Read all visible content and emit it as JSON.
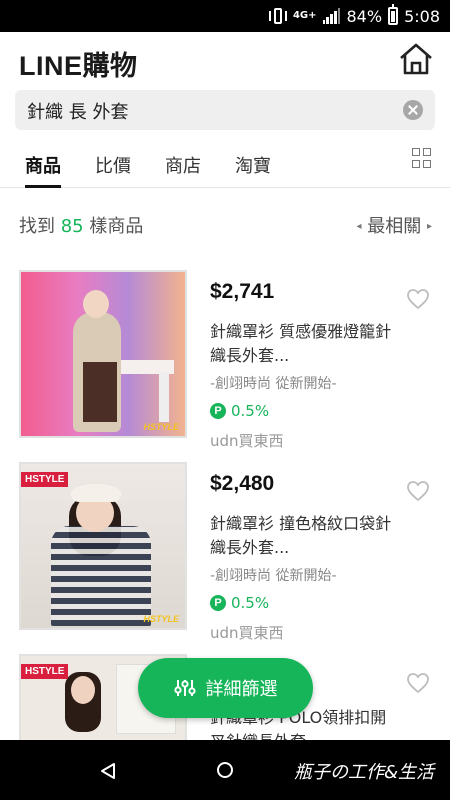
{
  "status_bar": {
    "network": "4G+",
    "battery": "84%",
    "time": "5:08",
    "icons": [
      "vibrate-icon",
      "network-4g-icon",
      "signal-icon",
      "battery-icon"
    ]
  },
  "header": {
    "logo": "LINE購物",
    "home_icon": "home-icon"
  },
  "search": {
    "query": "針織 長 外套",
    "clear_icon": "clear-icon"
  },
  "tabs": [
    {
      "label": "商品",
      "active": true
    },
    {
      "label": "比價",
      "active": false
    },
    {
      "label": "商店",
      "active": false
    },
    {
      "label": "淘寶",
      "active": false
    }
  ],
  "grid_view_icon": "grid-view-icon",
  "results": {
    "prefix": "找到 ",
    "count": "85",
    "suffix": " 樣商品",
    "sort_label": "最相關",
    "sort_prev_arrow": "◂",
    "sort_next_arrow": "▸"
  },
  "products": [
    {
      "price": "$2,741",
      "name": "針織罩衫 質感優雅燈籠針織長外套...",
      "shop": "-創翊時尚 從新開始-",
      "points": "0.5%",
      "store": "udn買東西",
      "image_brand": "HSTYLE",
      "point_badge": "P"
    },
    {
      "price": "$2,480",
      "name": "針織罩衫 撞色格紋口袋針織長外套...",
      "shop": "-創翊時尚 從新開始-",
      "points": "0.5%",
      "store": "udn買東西",
      "image_brand": "HSTYLE",
      "image_tag": "HSTYLE",
      "point_badge": "P"
    },
    {
      "name": "針織罩衫 POLO領排扣開叉針織長外套...",
      "image_tag": "HSTYLE"
    }
  ],
  "filter_button": {
    "label": "詳細篩選",
    "icon": "sliders-icon"
  },
  "nav_bar": {
    "watermark": "瓶子の工作&生活",
    "icons": [
      "back-icon",
      "home-circle-icon"
    ]
  },
  "colors": {
    "accent_green": "#16b55a",
    "brand_red": "#d81f3e"
  }
}
